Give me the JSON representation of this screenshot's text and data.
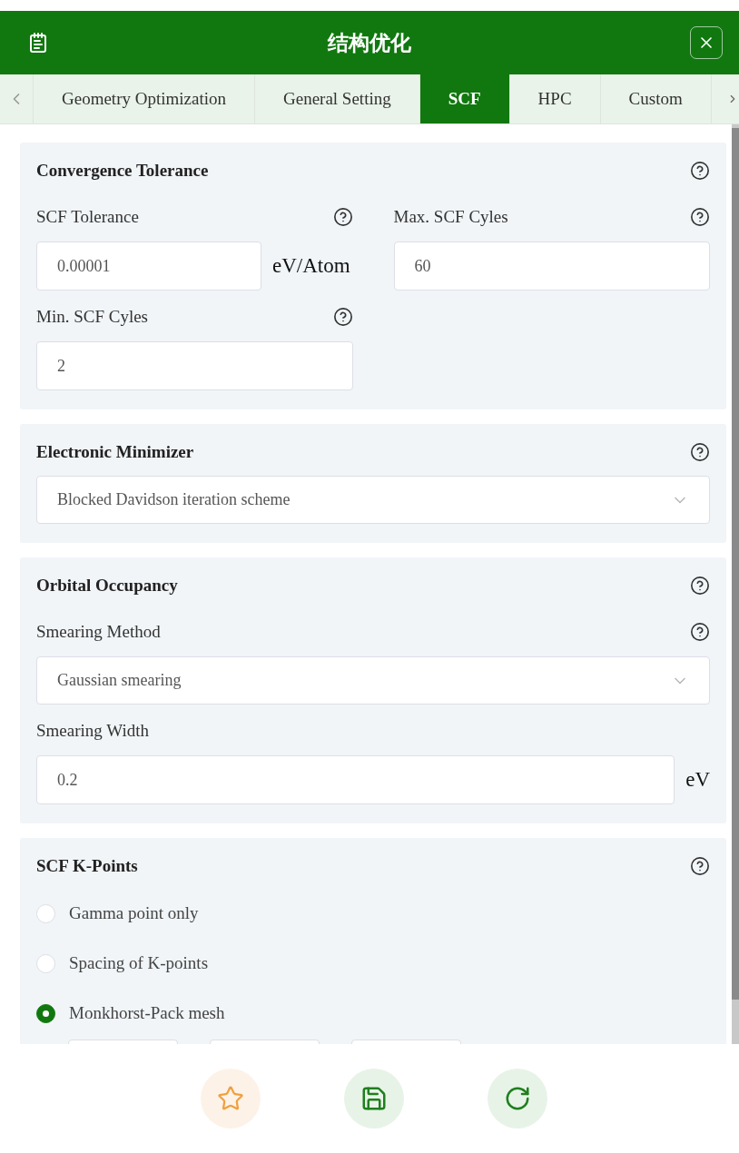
{
  "header": {
    "title": "结构优化"
  },
  "tabs": [
    {
      "label": "Geometry Optimization",
      "selected": false
    },
    {
      "label": "General Setting",
      "selected": false
    },
    {
      "label": "SCF",
      "selected": true
    },
    {
      "label": "HPC",
      "selected": false
    },
    {
      "label": "Custom",
      "selected": false
    }
  ],
  "sections": [
    {
      "title": "Convergence Tolerance",
      "kind": "grid",
      "fields": [
        {
          "kind": "input",
          "label": "SCF Tolerance",
          "help": true,
          "value": "0.00001",
          "unit": "eV/Atom"
        },
        {
          "kind": "input",
          "label": "Max. SCF Cyles",
          "help": true,
          "value": "60"
        },
        {
          "kind": "input",
          "label": "Min. SCF Cyles",
          "help": true,
          "value": "2"
        }
      ]
    },
    {
      "title": "Electronic Minimizer",
      "kind": "stack",
      "fields": [
        {
          "kind": "select",
          "value": "Blocked Davidson iteration scheme"
        }
      ]
    },
    {
      "title": "Orbital Occupancy",
      "kind": "stack",
      "fields": [
        {
          "kind": "select",
          "label": "Smearing Method",
          "help": true,
          "value": "Gaussian smearing"
        },
        {
          "kind": "input",
          "label": "Smearing Width",
          "help": false,
          "value": "0.2",
          "unit": "eV"
        }
      ]
    },
    {
      "title": "SCF K-Points",
      "kind": "stack",
      "fields": [
        {
          "kind": "radio",
          "label": "Gamma point only",
          "selected": false
        },
        {
          "kind": "radio",
          "label": "Spacing of K-points",
          "selected": false
        },
        {
          "kind": "radio",
          "label": "Monkhorst-Pack mesh",
          "selected": true
        },
        {
          "kind": "mesh"
        }
      ]
    }
  ],
  "actions": [
    {
      "kind": "favorite"
    },
    {
      "kind": "save"
    },
    {
      "kind": "reset"
    }
  ]
}
